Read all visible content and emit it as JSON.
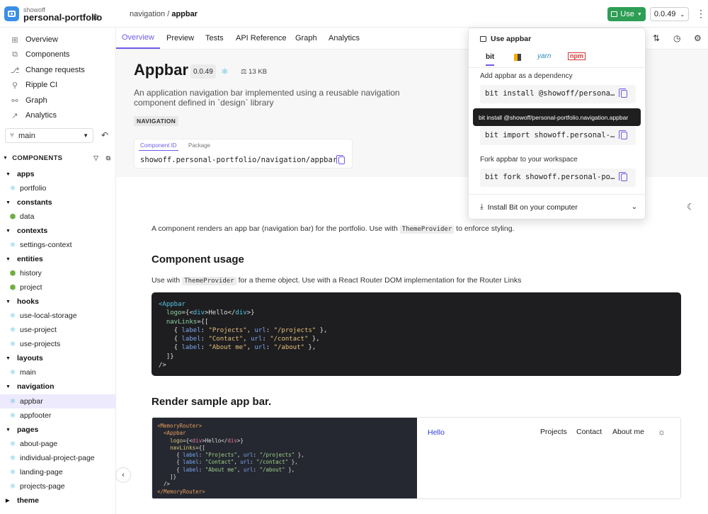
{
  "header": {
    "org": "showoff",
    "scope": "personal-portfolio",
    "breadcrumb_path": "navigation /",
    "breadcrumb_current": "appbar",
    "use_label": "Use",
    "version": "0.0.49"
  },
  "sidebar": {
    "nav": [
      {
        "label": "Overview",
        "icon": "grid-icon"
      },
      {
        "label": "Components",
        "icon": "components-icon"
      },
      {
        "label": "Change requests",
        "icon": "change-requests-icon"
      },
      {
        "label": "Ripple CI",
        "icon": "ripple-icon"
      },
      {
        "label": "Graph",
        "icon": "graph-icon"
      },
      {
        "label": "Analytics",
        "icon": "analytics-icon"
      }
    ],
    "lane": "main",
    "components_heading": "COMPONENTS",
    "tree": [
      {
        "ns": "apps",
        "items": [
          "portfolio"
        ]
      },
      {
        "ns": "constants",
        "items": [
          "data"
        ]
      },
      {
        "ns": "contexts",
        "items": [
          "settings-context"
        ]
      },
      {
        "ns": "entities",
        "items": [
          "history",
          "project"
        ]
      },
      {
        "ns": "hooks",
        "items": [
          "use-local-storage",
          "use-project",
          "use-projects"
        ]
      },
      {
        "ns": "layouts",
        "items": [
          "main"
        ]
      },
      {
        "ns": "navigation",
        "items": [
          "appbar",
          "appfooter"
        ]
      },
      {
        "ns": "pages",
        "items": [
          "about-page",
          "individual-project-page",
          "landing-page",
          "projects-page"
        ]
      },
      {
        "ns": "theme",
        "items": []
      }
    ]
  },
  "tabs": [
    "Overview",
    "Preview",
    "Tests",
    "API Reference",
    "Graph",
    "Analytics"
  ],
  "component": {
    "name": "Appbar",
    "version": "0.0.49",
    "size": "13 KB",
    "description": "An application navigation bar implemented using a reusable navigation component defined in `design` library",
    "tag": "NAVIGATION",
    "id_tab": "Component ID",
    "package_tab": "Package",
    "id_value": "showoff.personal-portfolio/navigation/appbar"
  },
  "docs": {
    "intro_pre": "A component renders an app bar (navigation bar) for the portfolio. Use with",
    "intro_code": "ThemeProvider",
    "intro_post": "to enforce styling.",
    "usage_heading": "Component usage",
    "usage_pre": "Use with",
    "usage_code": "ThemeProvider",
    "usage_post": "for a theme object. Use with a React Router DOM implementation for the Router Links",
    "render_heading": "Render sample app bar."
  },
  "code_lines": [
    [
      [
        "c-tag",
        "<Appbar"
      ]
    ],
    [
      [
        "",
        "  "
      ],
      [
        "c-attr",
        "logo"
      ],
      [
        "",
        "={<"
      ],
      [
        "c-tag",
        "div"
      ],
      [
        "",
        ">Hello</"
      ],
      [
        "c-tag",
        "div"
      ],
      [
        "",
        ">}"
      ]
    ],
    [
      [
        "",
        "  "
      ],
      [
        "c-attr",
        "navLinks"
      ],
      [
        "",
        "={["
      ]
    ],
    [
      [
        "",
        "    { "
      ],
      [
        "c-key",
        "label"
      ],
      [
        "",
        ": "
      ],
      [
        "c-str",
        "\"Projects\""
      ],
      [
        "",
        ", "
      ],
      [
        "c-key",
        "url"
      ],
      [
        "",
        ": "
      ],
      [
        "c-str",
        "\"/projects\""
      ],
      [
        "",
        " },"
      ]
    ],
    [
      [
        "",
        "    { "
      ],
      [
        "c-key",
        "label"
      ],
      [
        "",
        ": "
      ],
      [
        "c-str",
        "\"Contact\""
      ],
      [
        "",
        ", "
      ],
      [
        "c-key",
        "url"
      ],
      [
        "",
        ": "
      ],
      [
        "c-str",
        "\"/contact\""
      ],
      [
        "",
        " },"
      ]
    ],
    [
      [
        "",
        "    { "
      ],
      [
        "c-key",
        "label"
      ],
      [
        "",
        ": "
      ],
      [
        "c-str",
        "\"About me\""
      ],
      [
        "",
        ", "
      ],
      [
        "c-key",
        "url"
      ],
      [
        "",
        ": "
      ],
      [
        "c-str",
        "\"/about\""
      ],
      [
        "",
        " },"
      ]
    ],
    [
      [
        "",
        "  ]}"
      ]
    ],
    [
      [
        "",
        "/>"
      ]
    ]
  ],
  "preview_lines": [
    [
      [
        "pv-tag",
        "<MemoryRouter>"
      ]
    ],
    [
      [
        "",
        "  "
      ],
      [
        "pv-tag",
        "<Appbar"
      ]
    ],
    [
      [
        "",
        "    "
      ],
      [
        "pv-attr",
        "logo"
      ],
      [
        "",
        "={<"
      ],
      [
        "pv-el",
        "div"
      ],
      [
        "",
        ">Hello</"
      ],
      [
        "pv-el",
        "div"
      ],
      [
        "",
        ">}"
      ]
    ],
    [
      [
        "",
        "    "
      ],
      [
        "pv-attr",
        "navLinks"
      ],
      [
        "",
        "={["
      ]
    ],
    [
      [
        "",
        "      { "
      ],
      [
        "pv-key",
        "label"
      ],
      [
        "",
        ": "
      ],
      [
        "pv-str",
        "\"Projects\""
      ],
      [
        "",
        ", "
      ],
      [
        "pv-key",
        "url"
      ],
      [
        "",
        ": "
      ],
      [
        "pv-str",
        "\"/projects\""
      ],
      [
        "",
        " },"
      ]
    ],
    [
      [
        "",
        "      { "
      ],
      [
        "pv-key",
        "label"
      ],
      [
        "",
        ": "
      ],
      [
        "pv-str",
        "\"Contact\""
      ],
      [
        "",
        ", "
      ],
      [
        "pv-key",
        "url"
      ],
      [
        "",
        ": "
      ],
      [
        "pv-str",
        "\"/contact\""
      ],
      [
        "",
        " },"
      ]
    ],
    [
      [
        "",
        "      { "
      ],
      [
        "pv-key",
        "label"
      ],
      [
        "",
        ": "
      ],
      [
        "pv-str",
        "\"About me\""
      ],
      [
        "",
        ", "
      ],
      [
        "pv-key",
        "url"
      ],
      [
        "",
        ": "
      ],
      [
        "pv-str",
        "\"/about\""
      ],
      [
        "",
        " },"
      ]
    ],
    [
      [
        "",
        "    ]}"
      ]
    ],
    [
      [
        "",
        "  />"
      ]
    ],
    [
      [
        "pv-tag",
        "</MemoryRouter>"
      ]
    ]
  ],
  "preview_app": {
    "logo": "Hello",
    "links": [
      "Projects",
      "Contact",
      "About me"
    ]
  },
  "dropdown": {
    "title": "Use appbar",
    "tabs": {
      "bit": "bit",
      "yarn": "yarn",
      "npm": "npm"
    },
    "add_label": "Add appbar as a dependency",
    "install_cmd": "bit install @showoff/persona…",
    "import_cmd": "bit import showoff.personal-…",
    "fork_label": "Fork appbar to your workspace",
    "fork_cmd": "bit fork showoff.personal-po…",
    "footer": "Install Bit on your computer",
    "tooltip": "bit install @showoff/personal-portfolio.navigation.appbar"
  }
}
